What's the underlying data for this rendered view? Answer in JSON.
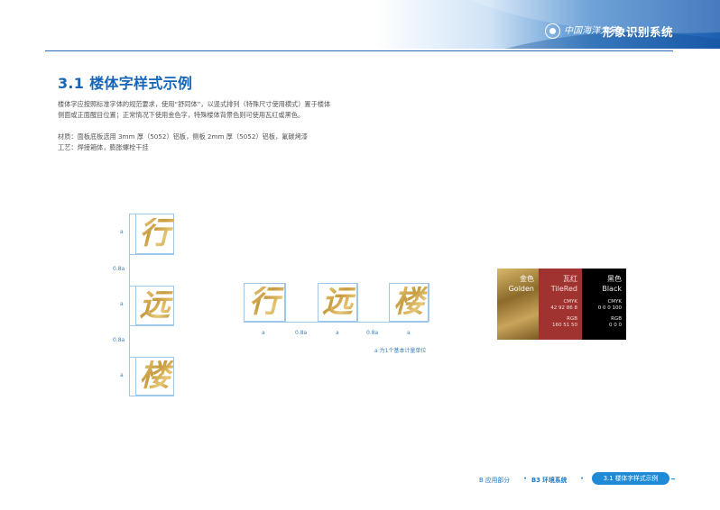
{
  "header": {
    "logo_script": "中国海洋大学",
    "title": "形象识别系统"
  },
  "page": {
    "title": "3.1 楼体字样式示例",
    "intro_line1": "楼体字应按照标准字体的规范要求，使用“舒同体”，以竖式排列（特殊尺寸使用横式）置于楼体",
    "intro_line2": "侧面或正面醒目位置；正常情况下使用金色字，特殊楼体背景色则可使用瓦红或黑色。",
    "material": "材质：面板底板选用 3mm 厚（5052）铝板，侧板 2mm 厚（5052）铝板，氟碳烤漆",
    "process": "工艺：焊接箱体，膨胀螺栓干挂"
  },
  "vertical": {
    "chars": [
      "行",
      "远",
      "楼"
    ],
    "dims": [
      "a",
      "0.8a",
      "a",
      "0.8a",
      "a"
    ]
  },
  "horizontal": {
    "chars": [
      "行",
      "远",
      "楼"
    ],
    "dims": [
      "a",
      "0.8a",
      "a",
      "0.8a",
      "a"
    ],
    "note": "a 为1个基本计量单位"
  },
  "swatches": [
    {
      "cn": "金色",
      "en": "Golden",
      "color": "#c9a45b"
    },
    {
      "cn": "瓦红",
      "en": "TileRed",
      "cmyk_label": "CMYK",
      "cmyk": "42 92 86 8",
      "rgb_label": "RGB",
      "rgb": "160 51 50",
      "color": "#a0332f"
    },
    {
      "cn": "黑色",
      "en": "Black",
      "cmyk_label": "CMYK",
      "cmyk": "0 0 0 100",
      "rgb_label": "RGB",
      "rgb": "0 0 0",
      "color": "#000000"
    }
  ],
  "footer": {
    "section": "B 应用部分",
    "sub": "B3 环境系统",
    "current": "3.1 楼体字样式示例",
    "dot": "•"
  },
  "colors": {
    "accent": "#1565b8",
    "gold": "#c9a45b",
    "tile_red": "#a0332f"
  }
}
